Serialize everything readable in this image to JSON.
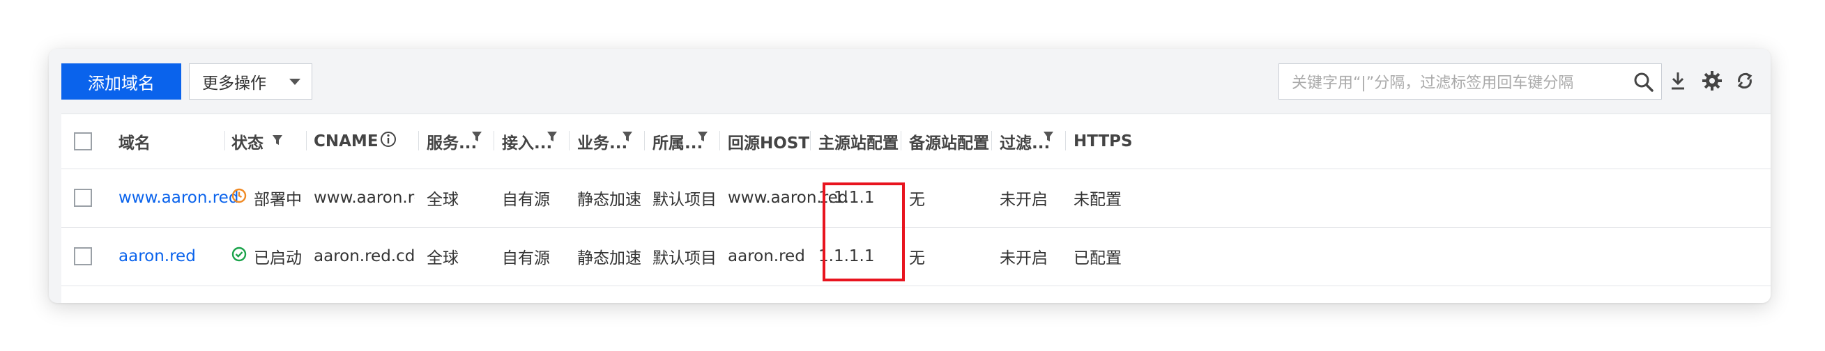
{
  "toolbar": {
    "add_domain_label": "添加域名",
    "more_actions_label": "更多操作",
    "search_placeholder": "关键字用“|”分隔，过滤标签用回车键分隔"
  },
  "table": {
    "headers": {
      "domain": "域名",
      "status": "状态",
      "cname": "CNAME",
      "service": "服务...",
      "access": "接入...",
      "business": "业务...",
      "project": "所属...",
      "host": "回源HOST",
      "primary": "主源站配置",
      "backup": "备源站配置",
      "filter": "过滤...",
      "https": "HTTPS"
    },
    "rows": [
      {
        "domain": "www.aaron.red",
        "status": "部署中",
        "cname": "www.aaron.red.cdn...",
        "service": "全球",
        "access": "自有源",
        "business": "静态加速",
        "project": "默认项目",
        "host": "www.aaron.red",
        "primary": "1.1.1.1",
        "backup": "无",
        "filter": "未开启",
        "https": "未配置"
      },
      {
        "domain": "aaron.red",
        "status": "已启动",
        "cname": "aaron.red.cdn.dnsv...",
        "service": "全球",
        "access": "自有源",
        "business": "静态加速",
        "project": "默认项目",
        "host": "aaron.red",
        "primary": "1.1.1.1",
        "backup": "无",
        "filter": "未开启",
        "https": "已配置"
      }
    ]
  },
  "colors": {
    "accent": "#0a63ec",
    "deploying": "#f08a24",
    "running": "#1aa34a",
    "highlight": "#e8141f"
  },
  "icons": [
    "search-icon",
    "download-icon",
    "gear-icon",
    "refresh-icon",
    "filter-icon",
    "info-icon",
    "clock-icon",
    "check-circle-icon"
  ]
}
